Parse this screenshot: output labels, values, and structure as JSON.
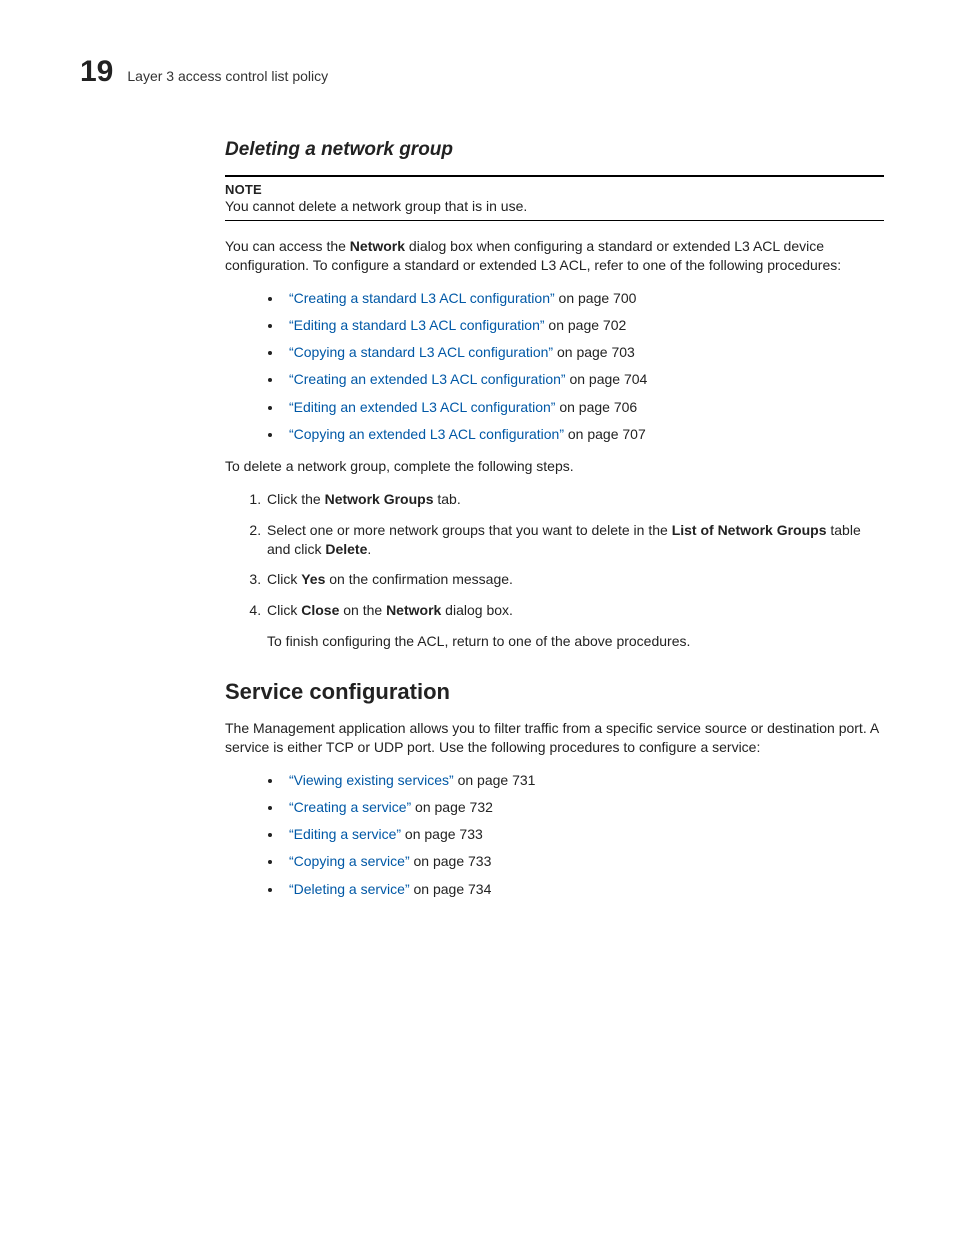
{
  "header": {
    "chapter_number": "19",
    "running_title": "Layer 3 access control list policy"
  },
  "section1": {
    "title": "Deleting a network group",
    "note_label": "NOTE",
    "note_text": "You cannot delete a network group that is in use.",
    "intro_pre": "You can access the ",
    "intro_bold": "Network",
    "intro_post": " dialog box when configuring a standard or extended L3 ACL device configuration. To configure a standard or extended L3 ACL, refer to one of the following procedures:",
    "links": [
      {
        "text": "“Creating a standard L3 ACL configuration”",
        "suffix": " on page 700"
      },
      {
        "text": "“Editing a standard L3 ACL configuration”",
        "suffix": " on page 702"
      },
      {
        "text": "“Copying a standard L3 ACL configuration”",
        "suffix": " on page 703"
      },
      {
        "text": "“Creating an extended L3 ACL configuration”",
        "suffix": " on page 704"
      },
      {
        "text": "“Editing an extended L3 ACL configuration”",
        "suffix": " on page 706"
      },
      {
        "text": "“Copying an extended L3 ACL configuration”",
        "suffix": " on page 707"
      }
    ],
    "lead_in": "To delete a network group, complete the following steps.",
    "step1_pre": "Click the ",
    "step1_bold": "Network Groups",
    "step1_post": " tab.",
    "step2_pre": "Select one or more network groups that you want to delete in the ",
    "step2_bold1": "List of Network Groups",
    "step2_mid": " table and click ",
    "step2_bold2": "Delete",
    "step2_end": ".",
    "step3_pre": "Click ",
    "step3_bold": "Yes",
    "step3_post": " on the confirmation message.",
    "step4_pre": "Click ",
    "step4_bold1": "Close",
    "step4_mid": " on the ",
    "step4_bold2": "Network",
    "step4_post": " dialog box.",
    "step4_sub": "To finish configuring the ACL, return to one of the above procedures."
  },
  "section2": {
    "title": "Service configuration",
    "intro": "The Management application allows you to filter traffic from a specific service source or destination port. A service is either TCP or UDP port. Use the following procedures to configure a service:",
    "links": [
      {
        "text": "“Viewing existing services”",
        "suffix": " on page 731"
      },
      {
        "text": "“Creating a service”",
        "suffix": " on page 732"
      },
      {
        "text": "“Editing a service”",
        "suffix": " on page 733"
      },
      {
        "text": "“Copying a service”",
        "suffix": " on page 733"
      },
      {
        "text": "“Deleting a service”",
        "suffix": " on page 734"
      }
    ]
  }
}
